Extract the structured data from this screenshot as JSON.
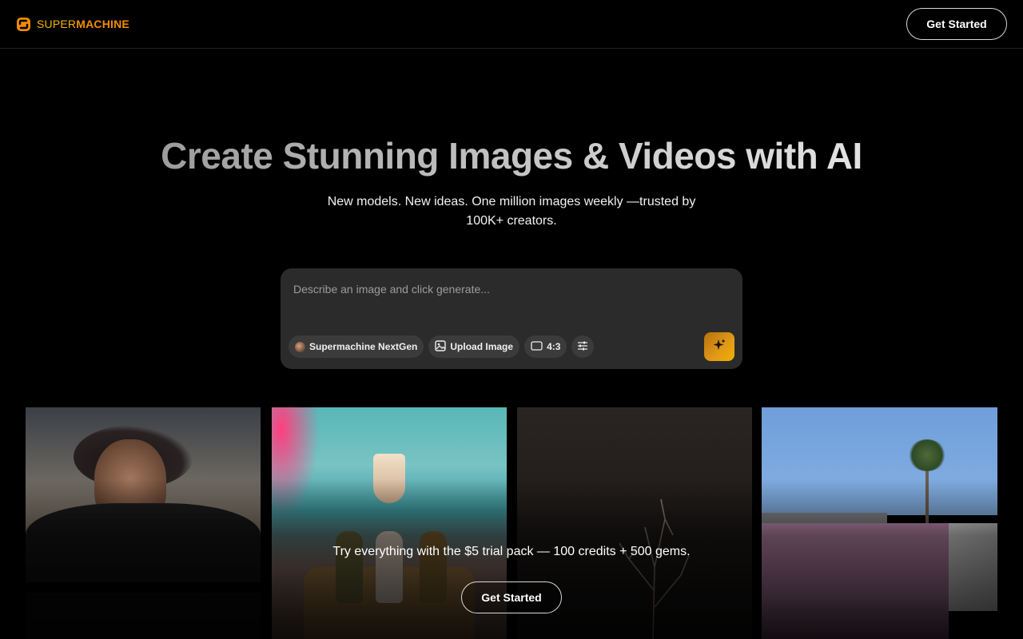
{
  "brand": {
    "name_part1": "SUPER",
    "name_part2": "MACHINE",
    "logo_icon": "supermachine-logo-icon"
  },
  "header": {
    "cta_label": "Get Started"
  },
  "hero": {
    "title": "Create Stunning Images & Videos with AI",
    "subtitle": "New models. New ideas. One million images weekly —trusted by 100K+ creators."
  },
  "prompt": {
    "placeholder": "Describe an image and click generate...",
    "value": "",
    "model_label": "Supermachine NextGen",
    "upload_label": "Upload Image",
    "aspect_label": "4:3",
    "settings_icon": "sliders-icon",
    "generate_icon": "sparkles-icon"
  },
  "gallery": {
    "tiles": [
      "portrait-woman-car-window",
      "wedding-party-room",
      "bare-branches-dark",
      "pink-wall-palm-tree"
    ]
  },
  "promo": {
    "text": "Try everything with the $5 trial pack — 100 credits + 500 gems.",
    "cta_label": "Get Started"
  },
  "colors": {
    "accent": "#f08c00",
    "accent_light": "#f5b400",
    "background": "#000000",
    "panel": "#2b2b2b"
  }
}
